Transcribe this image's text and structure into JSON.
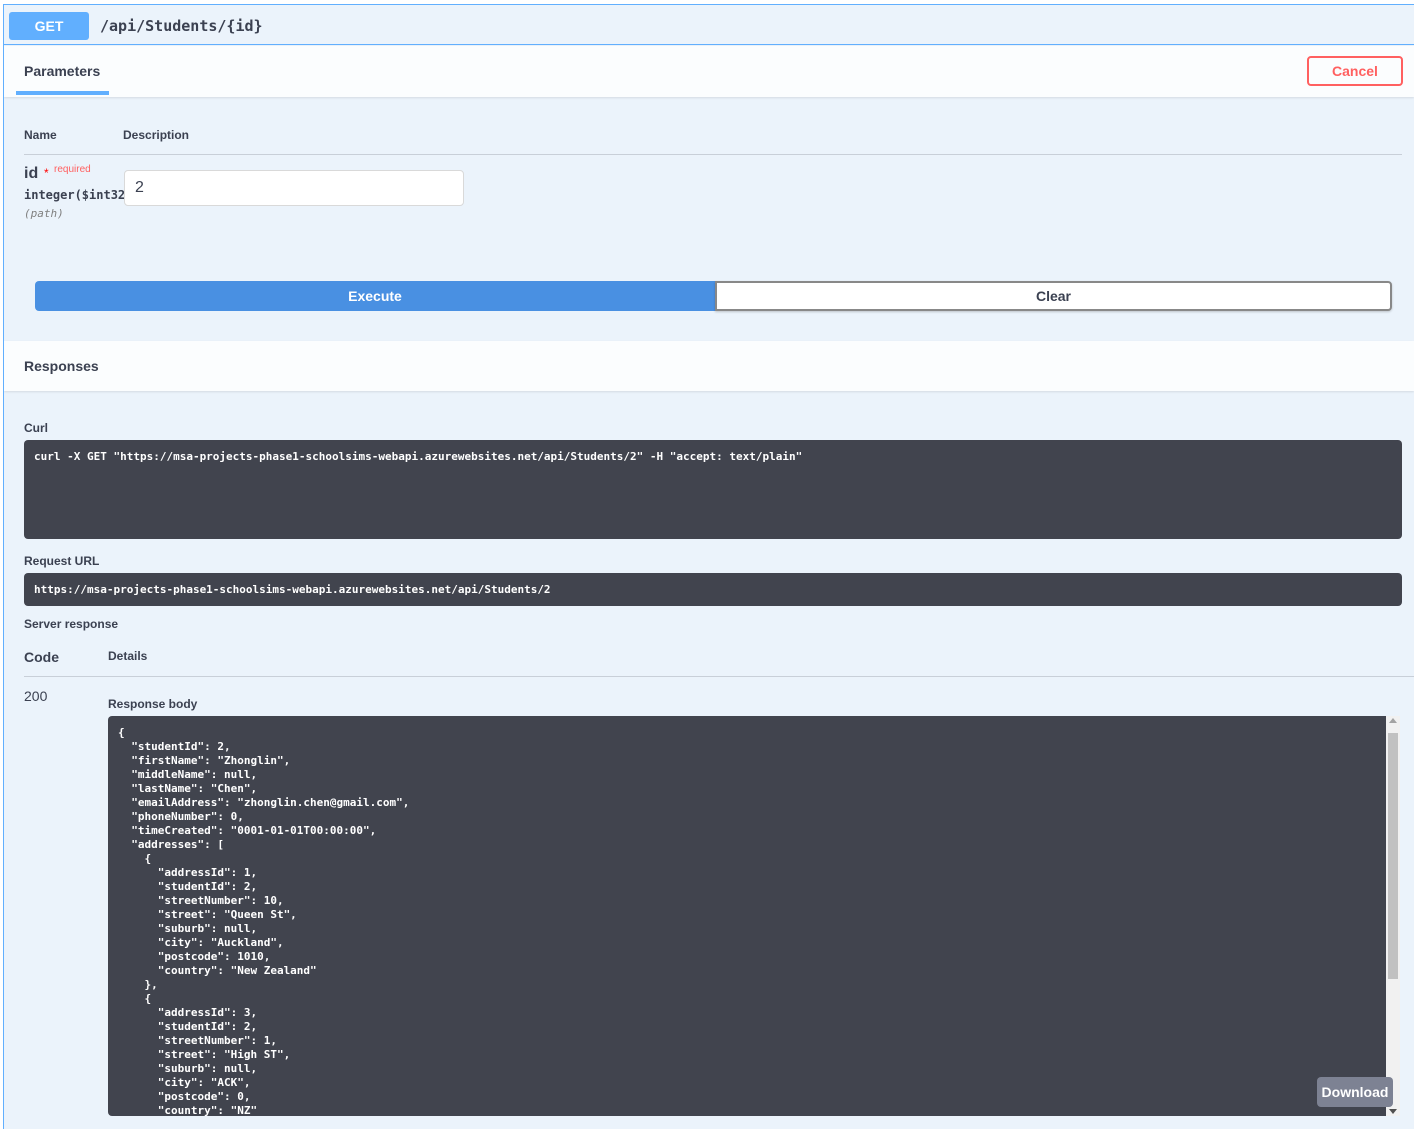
{
  "endpoint": {
    "method": "GET",
    "path": "/api/Students/{id}"
  },
  "tabs": {
    "parameters_label": "Parameters",
    "cancel_label": "Cancel"
  },
  "params_table": {
    "name_header": "Name",
    "description_header": "Description",
    "param": {
      "name": "id",
      "required_mark": "*",
      "required_label": "required",
      "type": "integer($int32)",
      "in": "(path)",
      "value": "2"
    }
  },
  "actions": {
    "execute_label": "Execute",
    "clear_label": "Clear"
  },
  "responses": {
    "title": "Responses",
    "curl_label": "Curl",
    "curl_command": "curl -X GET \"https://msa-projects-phase1-schoolsims-webapi.azurewebsites.net/api/Students/2\" -H \"accept: text/plain\"",
    "request_url_label": "Request URL",
    "request_url": "https://msa-projects-phase1-schoolsims-webapi.azurewebsites.net/api/Students/2",
    "server_response_label": "Server response",
    "code_header": "Code",
    "details_header": "Details",
    "status_code": "200",
    "response_body_label": "Response body",
    "response_body": "{\n  \"studentId\": 2,\n  \"firstName\": \"Zhonglin\",\n  \"middleName\": null,\n  \"lastName\": \"Chen\",\n  \"emailAddress\": \"zhonglin.chen@gmail.com\",\n  \"phoneNumber\": 0,\n  \"timeCreated\": \"0001-01-01T00:00:00\",\n  \"addresses\": [\n    {\n      \"addressId\": 1,\n      \"studentId\": 2,\n      \"streetNumber\": 10,\n      \"street\": \"Queen St\",\n      \"suburb\": null,\n      \"city\": \"Auckland\",\n      \"postcode\": 1010,\n      \"country\": \"New Zealand\"\n    },\n    {\n      \"addressId\": 3,\n      \"studentId\": 2,\n      \"streetNumber\": 1,\n      \"street\": \"High ST\",\n      \"suburb\": null,\n      \"city\": \"ACK\",\n      \"postcode\": 0,\n      \"country\": \"NZ\"",
    "download_label": "Download"
  },
  "colors": {
    "get_accent": "#61affe",
    "block_bg": "#ebf3fb",
    "execute_bg": "#4990e2",
    "cancel_red": "#ff6060",
    "code_bg": "#41444e"
  }
}
